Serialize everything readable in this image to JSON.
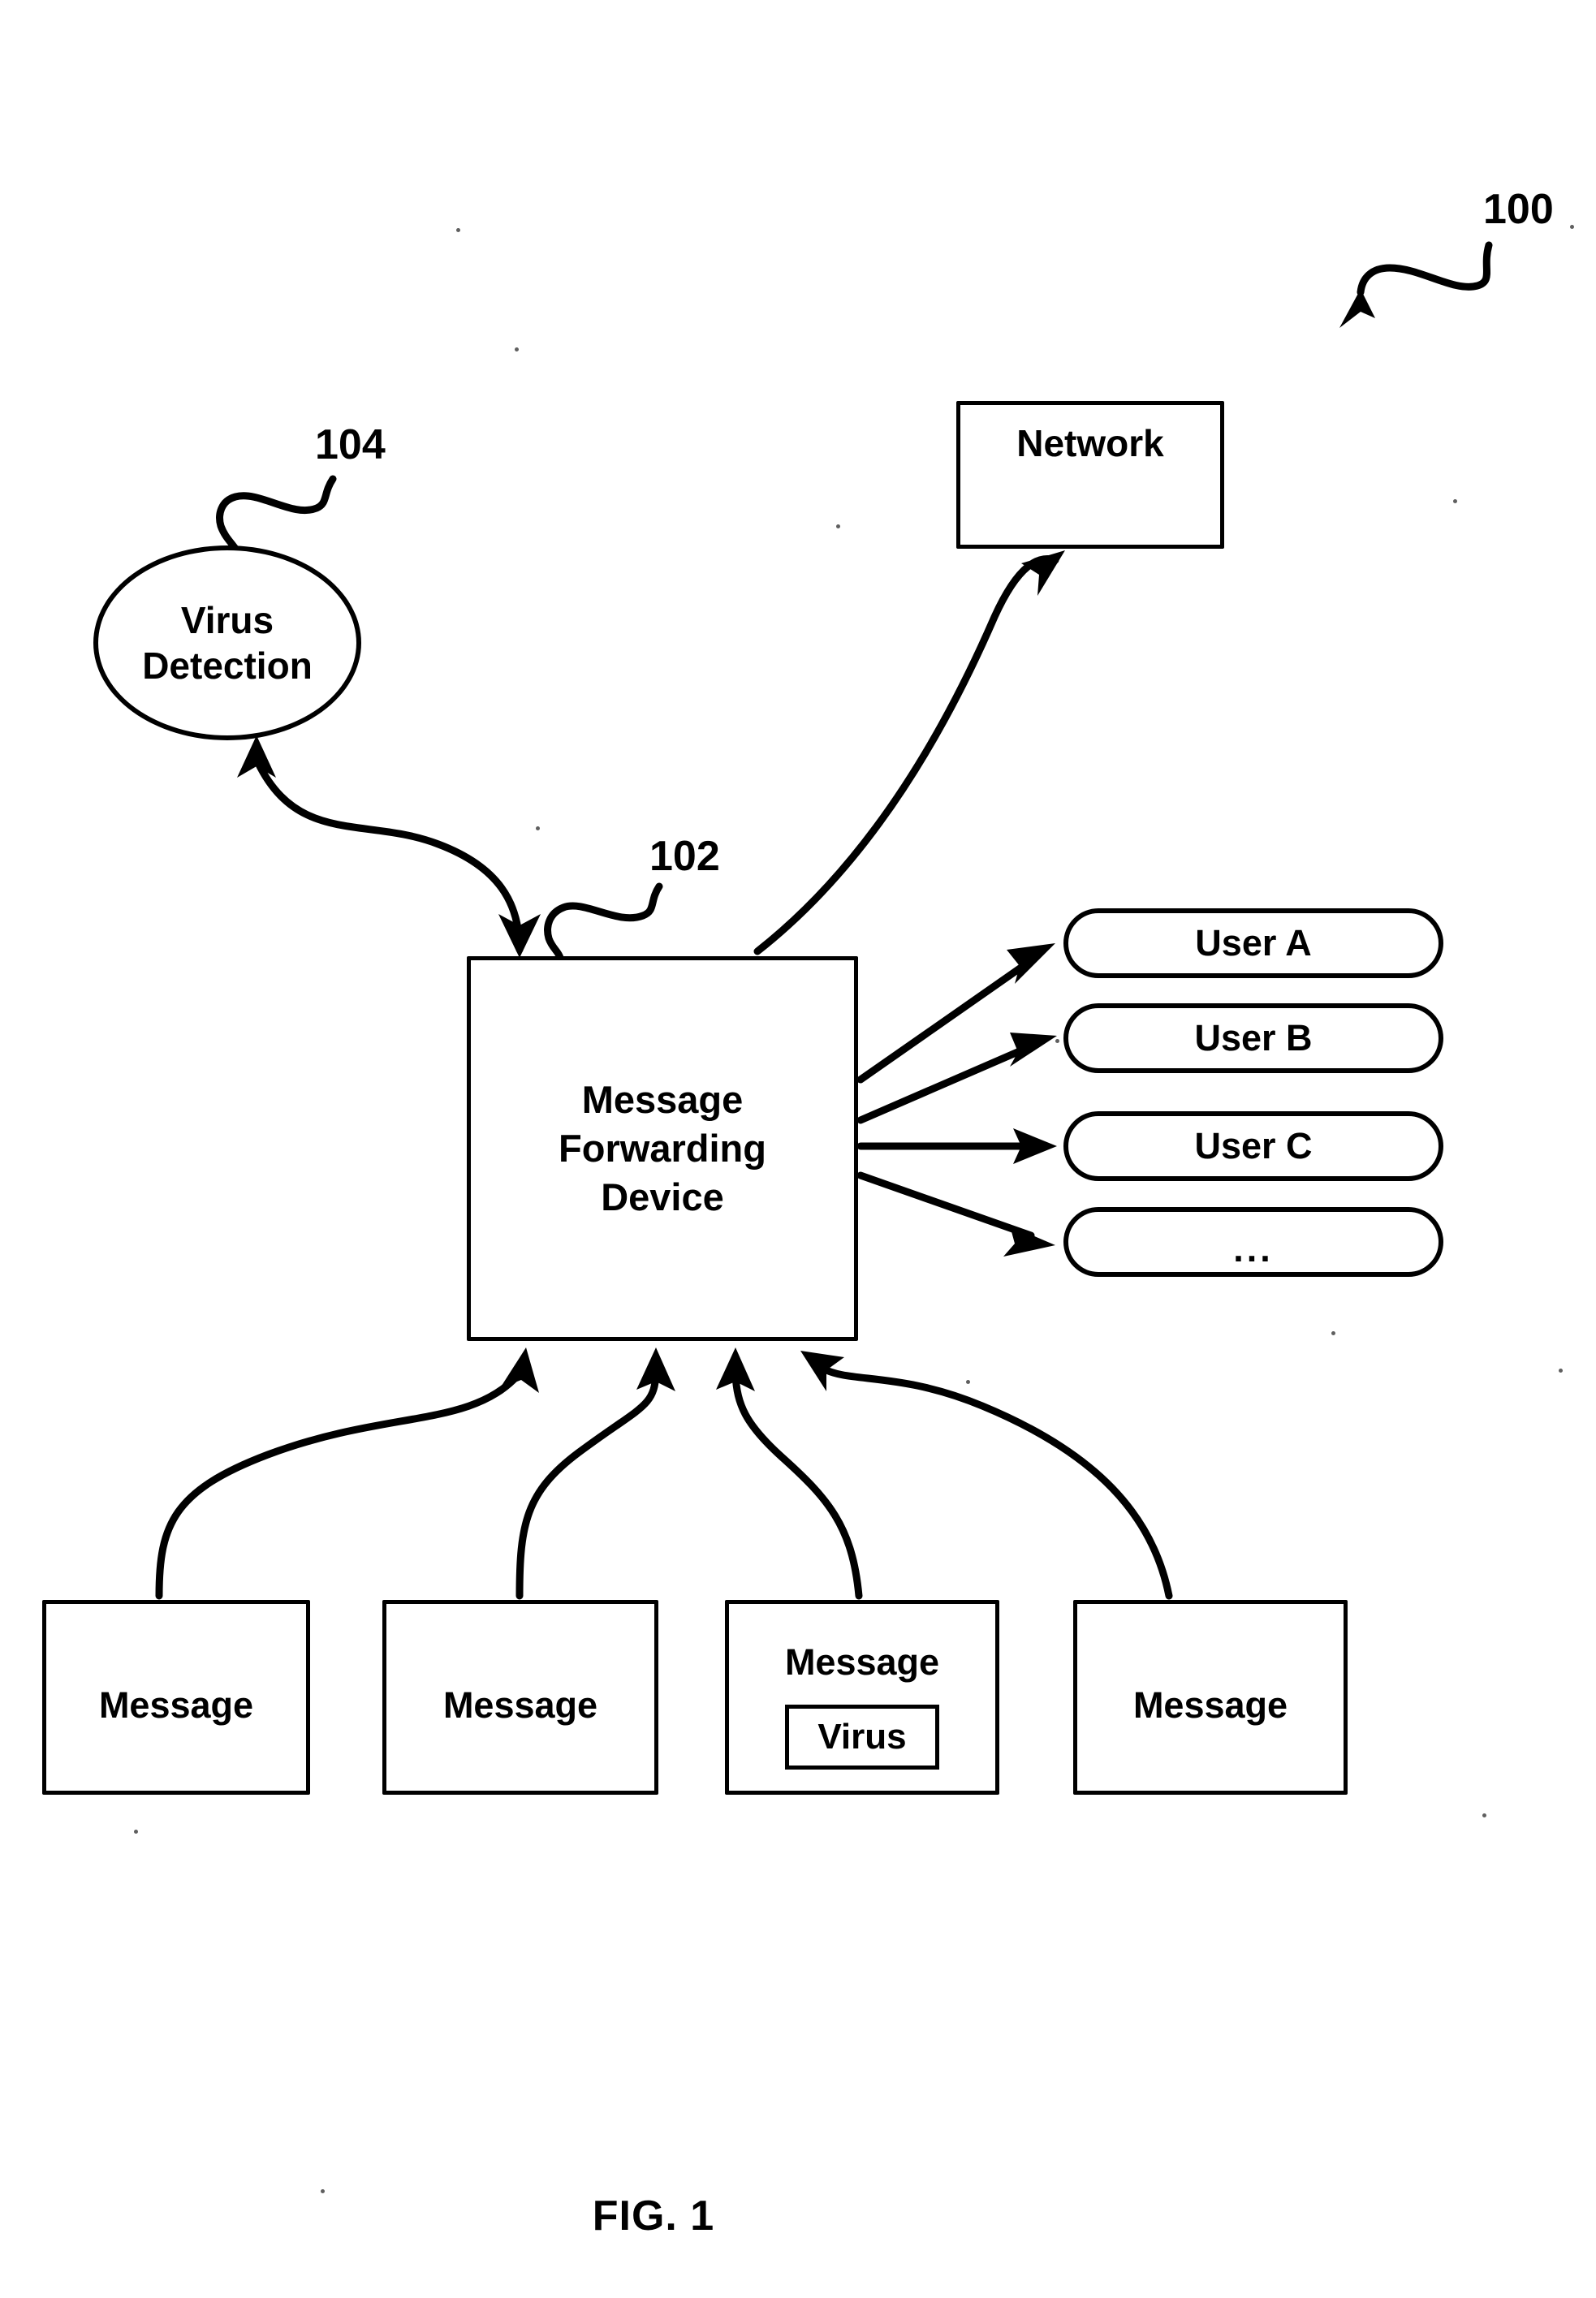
{
  "figure": {
    "caption": "FIG. 1",
    "system_ref": "100"
  },
  "nodes": {
    "network": {
      "label": "Network",
      "shape": "rectangle"
    },
    "virus_detection": {
      "label": "Virus\nDetection",
      "line1": "Virus",
      "line2": "Detection",
      "ref": "104",
      "shape": "ellipse"
    },
    "message_forwarding_device": {
      "line1": "Message",
      "line2": "Forwarding",
      "line3": "Device",
      "ref": "102",
      "shape": "rectangle"
    }
  },
  "recipients": {
    "items": [
      {
        "label": "User A"
      },
      {
        "label": "User B"
      },
      {
        "label": "User C"
      },
      {
        "label": "..."
      }
    ]
  },
  "messages": {
    "items": [
      {
        "label": "Message",
        "virus": null
      },
      {
        "label": "Message",
        "virus": null
      },
      {
        "label": "Message",
        "virus": "Virus"
      },
      {
        "label": "Message",
        "virus": null
      }
    ]
  },
  "colors": {
    "stroke": "#000000",
    "background": "#ffffff"
  }
}
